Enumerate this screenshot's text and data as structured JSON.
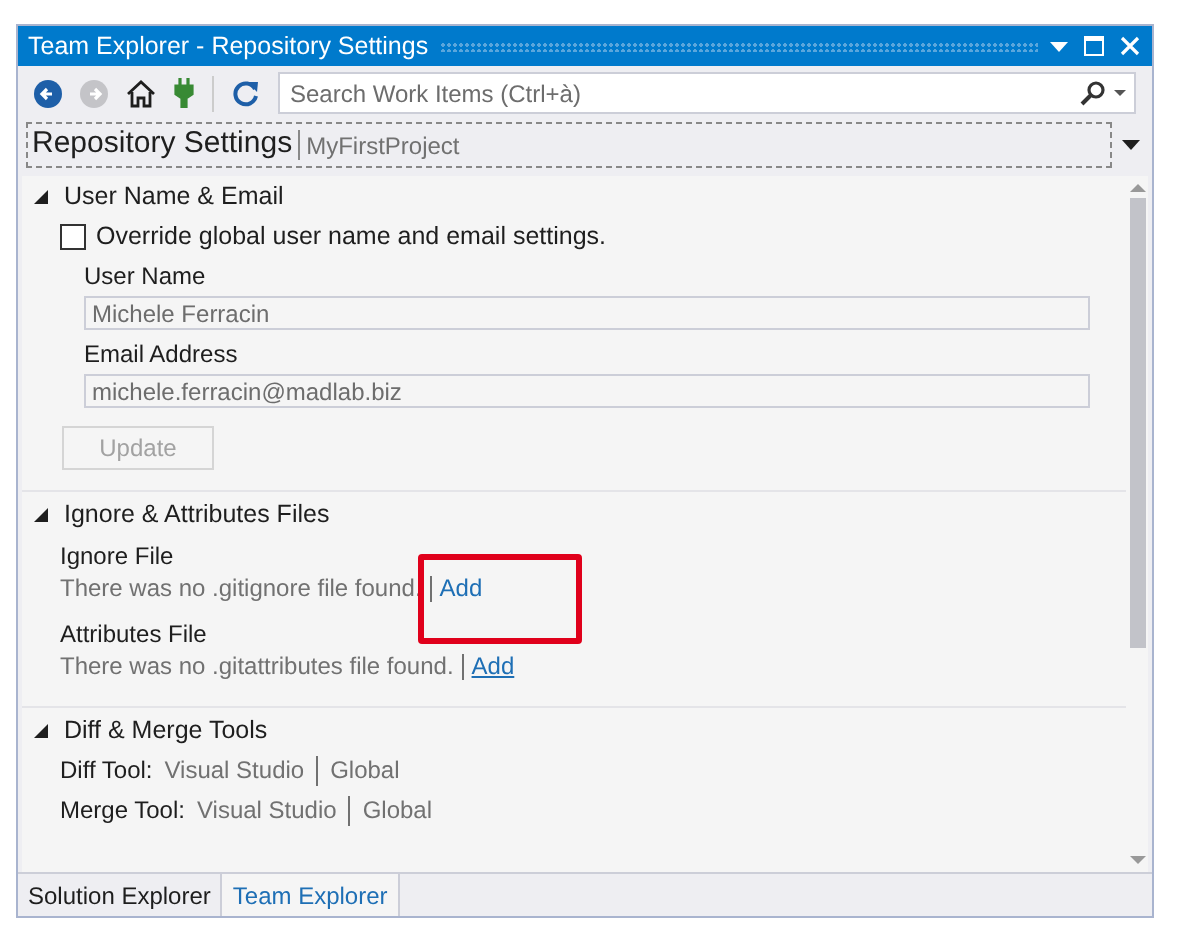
{
  "window": {
    "title": "Team Explorer - Repository Settings"
  },
  "search": {
    "placeholder": "Search Work Items (Ctrl+à)"
  },
  "header": {
    "title": "Repository Settings",
    "project": "MyFirstProject"
  },
  "sections": [
    {
      "kind": "user",
      "title": "User Name & Email",
      "expanded": true,
      "checkbox": {
        "label": "Override global user name and email settings.",
        "checked": false
      },
      "fields": [
        {
          "label": "User Name",
          "value": "Michele Ferracin"
        },
        {
          "label": "Email Address",
          "value": "michele.ferracin@madlab.biz"
        }
      ],
      "button": {
        "label": "Update",
        "disabled": true
      }
    },
    {
      "kind": "files",
      "title": "Ignore & Attributes Files",
      "expanded": true,
      "files": [
        {
          "label": "Ignore File",
          "message": "There was no .gitignore file found.",
          "link": "Add",
          "hovered": false,
          "highlighted": true
        },
        {
          "label": "Attributes File",
          "message": "There was no .gitattributes file found.",
          "link": "Add",
          "hovered": true,
          "highlighted": false
        }
      ]
    },
    {
      "kind": "tools",
      "title": "Diff & Merge Tools",
      "expanded": true,
      "tools": [
        {
          "label": "Diff Tool:",
          "value": "Visual Studio",
          "scope": "Global"
        },
        {
          "label": "Merge Tool:",
          "value": "Visual Studio",
          "scope": "Global"
        }
      ]
    }
  ],
  "tabs": [
    {
      "label": "Solution Explorer",
      "selected": false
    },
    {
      "label": "Team Explorer",
      "selected": true
    }
  ]
}
